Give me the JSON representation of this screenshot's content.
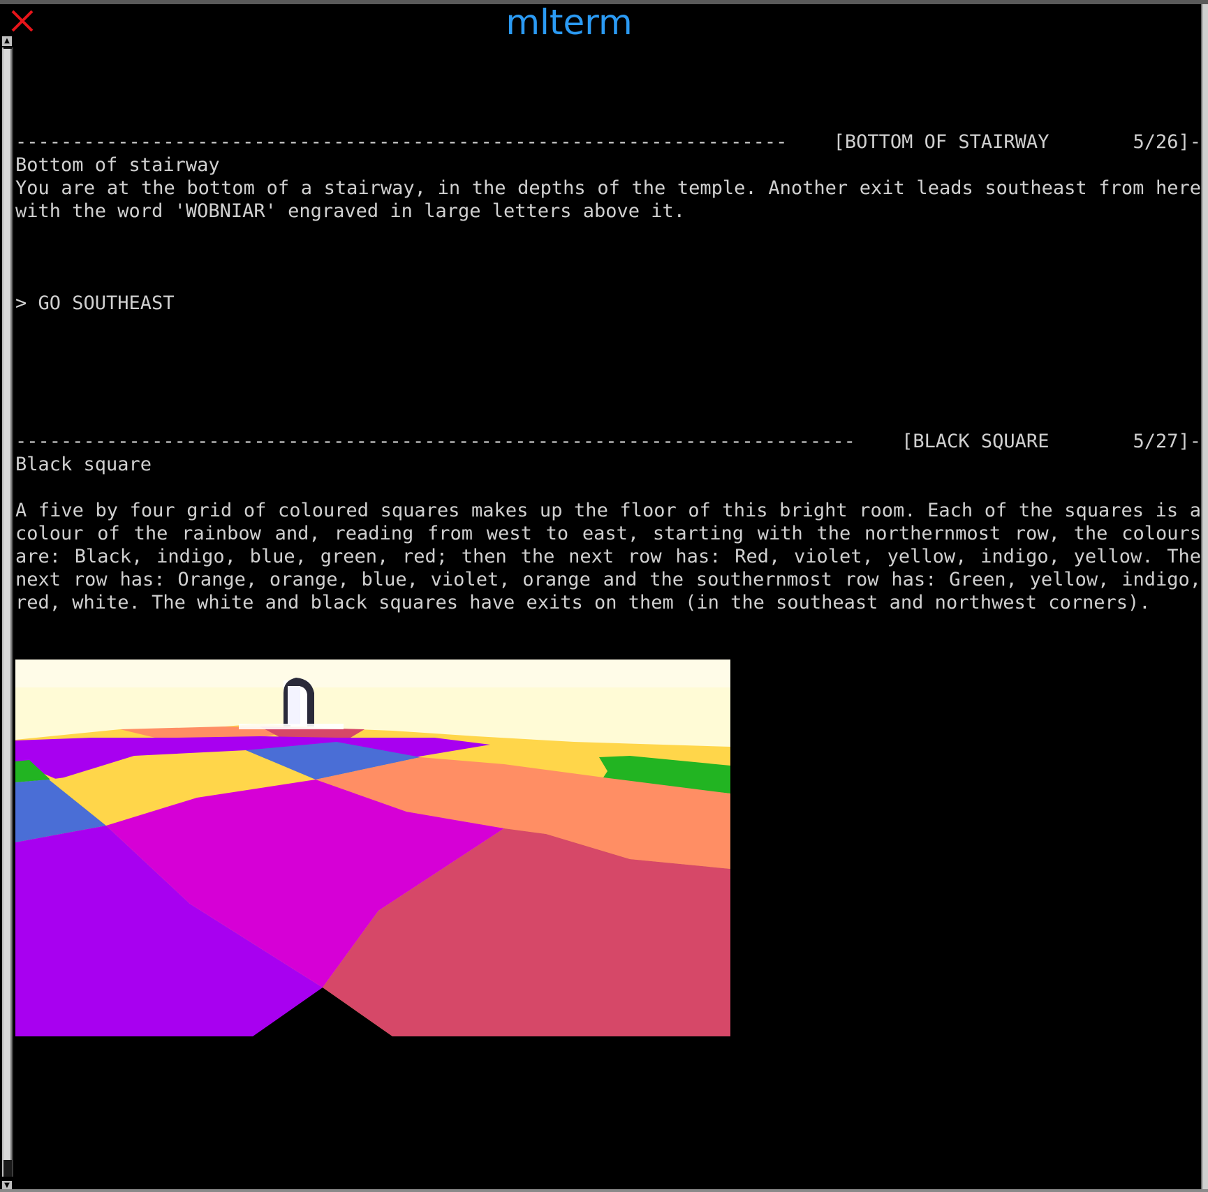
{
  "window": {
    "title": "mlterm",
    "close_glyph": "X",
    "close_color": "#e8141a",
    "title_color": "#2b9af3"
  },
  "scrollbar": {
    "up_glyph": "▲",
    "down_glyph": "▼"
  },
  "terminal": {
    "status_1": {
      "dashes": "--------------------------------------------------------------------",
      "room": "[BOTTOM OF STAIRWAY",
      "moves": "5/26]-"
    },
    "room_1": {
      "title": "Bottom of stairway",
      "description": "You are at the bottom of a stairway, in the depths of the temple. Another exit leads southeast  from here with the word 'WOBNIAR' engraved in large letters above it."
    },
    "command": "> GO SOUTHEAST",
    "status_2": {
      "dashes": "--------------------------------------------------------------------------",
      "room": "[BLACK SQUARE",
      "moves": "5/27]-"
    },
    "room_2": {
      "title": "Black square",
      "description": "A five by four grid of coloured squares makes up the floor of this bright room. Each of the  squares is a colour of the rainbow and, reading from  west to east, starting with the northernmost row,  the colours are: Black, indigo, blue,  green, red; then the next  row has: Red, violet, yellow,  indigo, yellow. The next row has: Orange, orange, blue, violet, orange and the southernmost row has:  Green, yellow, indigo, red, white.  The white and black  squares have exits on  them (in the southeast  and northwest corners)."
    },
    "prompt": ">"
  },
  "scene_colors": {
    "sky": "#fffbd6",
    "violet": "#a800f0",
    "magenta": "#d600d6",
    "red": "#d64868",
    "orange": "#ff8e64",
    "yellow": "#ffd64a",
    "blue": "#4a6ed6",
    "green": "#22b422",
    "black": "#000000"
  }
}
